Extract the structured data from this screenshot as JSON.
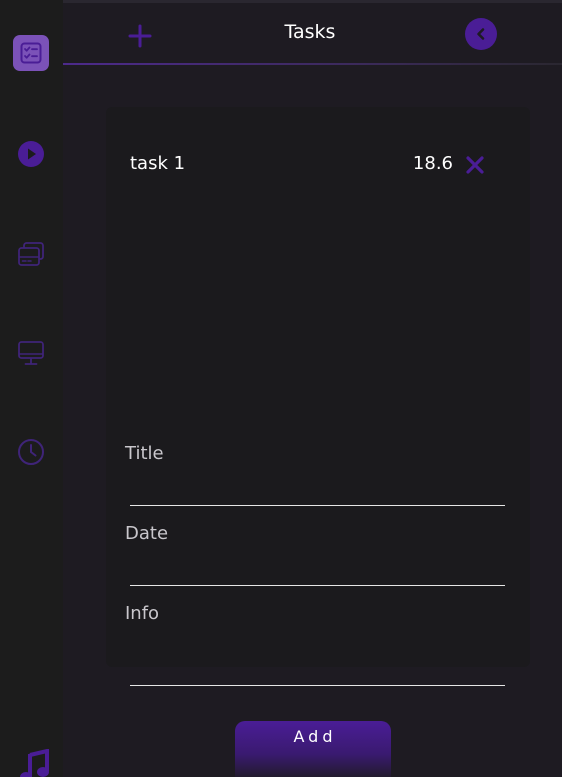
{
  "header": {
    "title": "Tasks"
  },
  "sidebar": {
    "items": [
      {
        "icon": "checklist-icon",
        "active": true
      },
      {
        "icon": "play-icon",
        "active": false
      },
      {
        "icon": "cards-icon",
        "active": false
      },
      {
        "icon": "monitor-icon",
        "active": false
      },
      {
        "icon": "clock-icon",
        "active": false
      },
      {
        "icon": "music-icon",
        "active": false
      }
    ]
  },
  "tasks": [
    {
      "name": "task 1",
      "value": "18.6"
    }
  ],
  "form": {
    "title_label": "Title",
    "date_label": "Date",
    "info_label": "Info",
    "title_value": "",
    "date_value": "",
    "info_value": "",
    "add_label": "Add"
  },
  "colors": {
    "accent": "#4a1d96",
    "active_tab": "#7b52b8",
    "sidebar_bg": "#1c1c1c",
    "main_bg": "#1e1b22",
    "card_bg": "#1b1a1d"
  }
}
